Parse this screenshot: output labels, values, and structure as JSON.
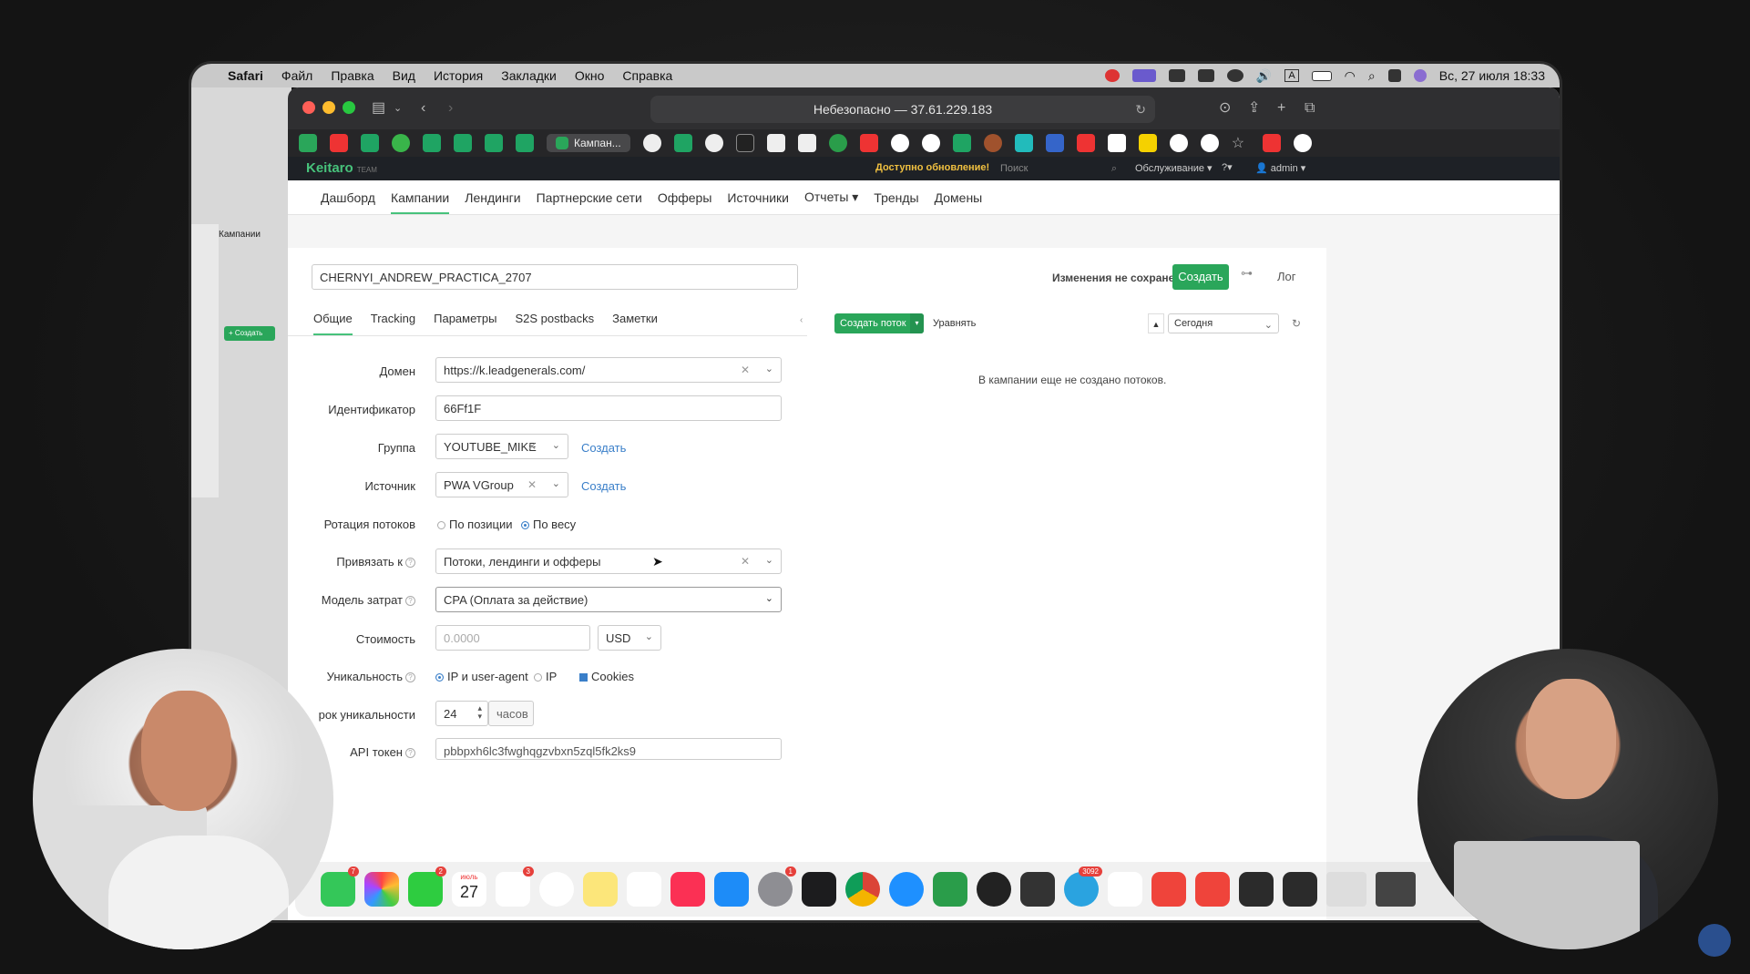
{
  "menubar": {
    "app": "Safari",
    "items": [
      "Файл",
      "Правка",
      "Вид",
      "История",
      "Закладки",
      "Окно",
      "Справка"
    ],
    "datetime": "Вс, 27 июля  18:33"
  },
  "browser": {
    "url": "Небезопасно — 37.61.229.183",
    "active_tab": "Кампан..."
  },
  "keitaro": {
    "logo": "Keitaro",
    "logo_sub": "TEAM",
    "update": "Доступно обновление!",
    "search_placeholder": "Поиск",
    "service": "Обслуживание ▾",
    "admin": "admin ▾",
    "nav": [
      "Дашборд",
      "Кампании",
      "Лендинги",
      "Партнерские сети",
      "Офферы",
      "Источники",
      "Отчеты ▾",
      "Тренды",
      "Домены"
    ]
  },
  "campaign": {
    "name": "CHERNYI_ANDREW_PRACTICA_2707",
    "unsaved": "Изменения не сохранены",
    "create": "Создать",
    "log": "Лог",
    "tabs": [
      "Общие",
      "Tracking",
      "Параметры",
      "S2S postbacks",
      "Заметки"
    ],
    "domain_label": "Домен",
    "domain": "https://k.leadgenerals.com/",
    "id_label": "Идентификатор",
    "id": "66Ff1F",
    "group_label": "Группа",
    "group": "YOUTUBE_MIKE",
    "group_create": "Создать",
    "source_label": "Источник",
    "source": "PWA VGroup",
    "source_create": "Создать",
    "rotation_label": "Ротация потоков",
    "rotation_opt1": "По позиции",
    "rotation_opt2": "По весу",
    "bind_label": "Привязать к",
    "bind": "Потоки, лендинги и офферы",
    "cost_model_label": "Модель затрат",
    "cost_model": "CPA (Оплата за действие)",
    "cost_label": "Стоимость",
    "cost_placeholder": "0.0000",
    "currency": "USD",
    "uniq_label": "Уникальность",
    "uniq_opt1": "IP и user-agent",
    "uniq_opt2": "IP",
    "uniq_opt3": "Cookies",
    "uniq_term_label": "рок уникальности",
    "uniq_term": "24",
    "uniq_unit": "часов",
    "api_label": "API токен",
    "api_token": "pbbpxh6lc3fwghqgzvbxn5zql5fk2ks9"
  },
  "flows": {
    "create_flow": "Создать поток",
    "equalize": "Уравнять",
    "period": "Сегодня",
    "empty": "В кампании еще не создано потоков."
  },
  "dock": {
    "calendar_month": "июль",
    "calendar_day": "27",
    "badges": [
      "7",
      "2",
      "3",
      "1",
      "3092"
    ]
  },
  "colors": {
    "accent_green": "#2aa65a",
    "link_blue": "#3a7fc9",
    "update_yellow": "#f0c040"
  }
}
